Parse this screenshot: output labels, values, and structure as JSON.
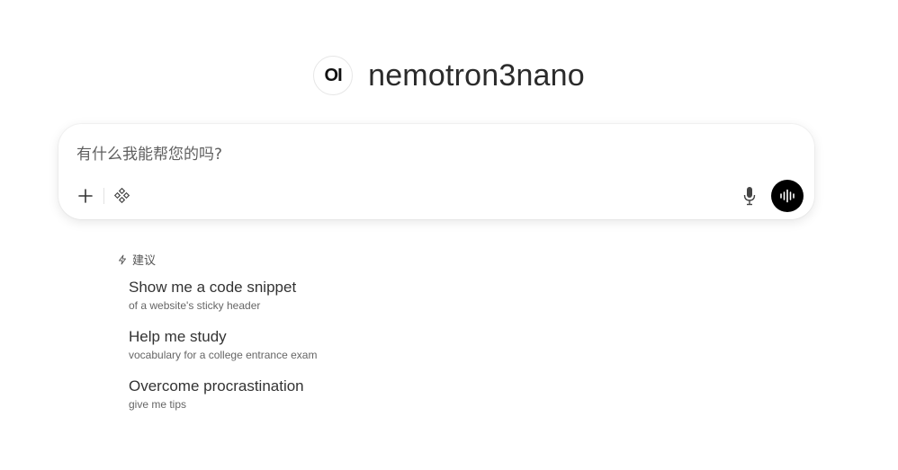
{
  "header": {
    "logo_text": "OI",
    "model_name": "nemotron3nano"
  },
  "composer": {
    "placeholder": "有什么我能帮您的吗?",
    "icons": {
      "add": "plus-icon",
      "tools": "tools-icon",
      "mic": "microphone-icon",
      "voice": "voice-waveform-icon"
    }
  },
  "suggestions": {
    "header": "建议",
    "header_icon": "lightning-bolt-icon",
    "items": [
      {
        "title": "Show me a code snippet",
        "subtitle": "of a website's sticky header"
      },
      {
        "title": "Help me study",
        "subtitle": "vocabulary for a college entrance exam"
      },
      {
        "title": "Overcome procrastination",
        "subtitle": "give me tips"
      }
    ]
  },
  "colors": {
    "voice_button": "#000000",
    "background": "#ffffff"
  }
}
